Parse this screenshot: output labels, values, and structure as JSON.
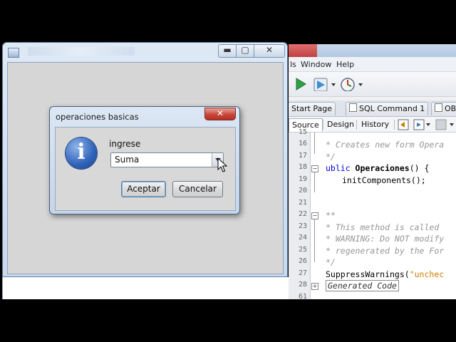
{
  "ide": {
    "menu": [
      "ls",
      "Window",
      "Help"
    ],
    "tabs": [
      "Start Page",
      "SQL Command 1",
      "OB"
    ],
    "view_tabs": [
      "Source",
      "Design",
      "History"
    ],
    "line_numbers": [
      "15",
      "16",
      "17",
      "18",
      "19",
      "20",
      "21",
      "22",
      "23",
      "24",
      "25",
      "26",
      "27",
      "28",
      "61"
    ],
    "code": {
      "l16": "* Creates new form Opera",
      "l17": "*/",
      "l18_kw": "ublic ",
      "l18_name": "Operaciones",
      "l18_rest": "() {",
      "l19": "initComponents();",
      "l22": "**",
      "l23": "* This method is called",
      "l24": "* WARNING: Do NOT modify",
      "l25": "* regenerated by the For",
      "l26": "*/",
      "l27_a": "SuppressWarnings(",
      "l27_b": "\"unchec",
      "l28": "Generated Code"
    }
  },
  "frame": {
    "minimize": "▬",
    "maximize": "▢",
    "close": "✕"
  },
  "dialog": {
    "title": "operaciones basicas",
    "close": "✕",
    "icon_glyph": "i",
    "prompt": "ingrese",
    "combo_value": "Suma",
    "ok_label": "Aceptar",
    "cancel_label": "Cancelar"
  }
}
